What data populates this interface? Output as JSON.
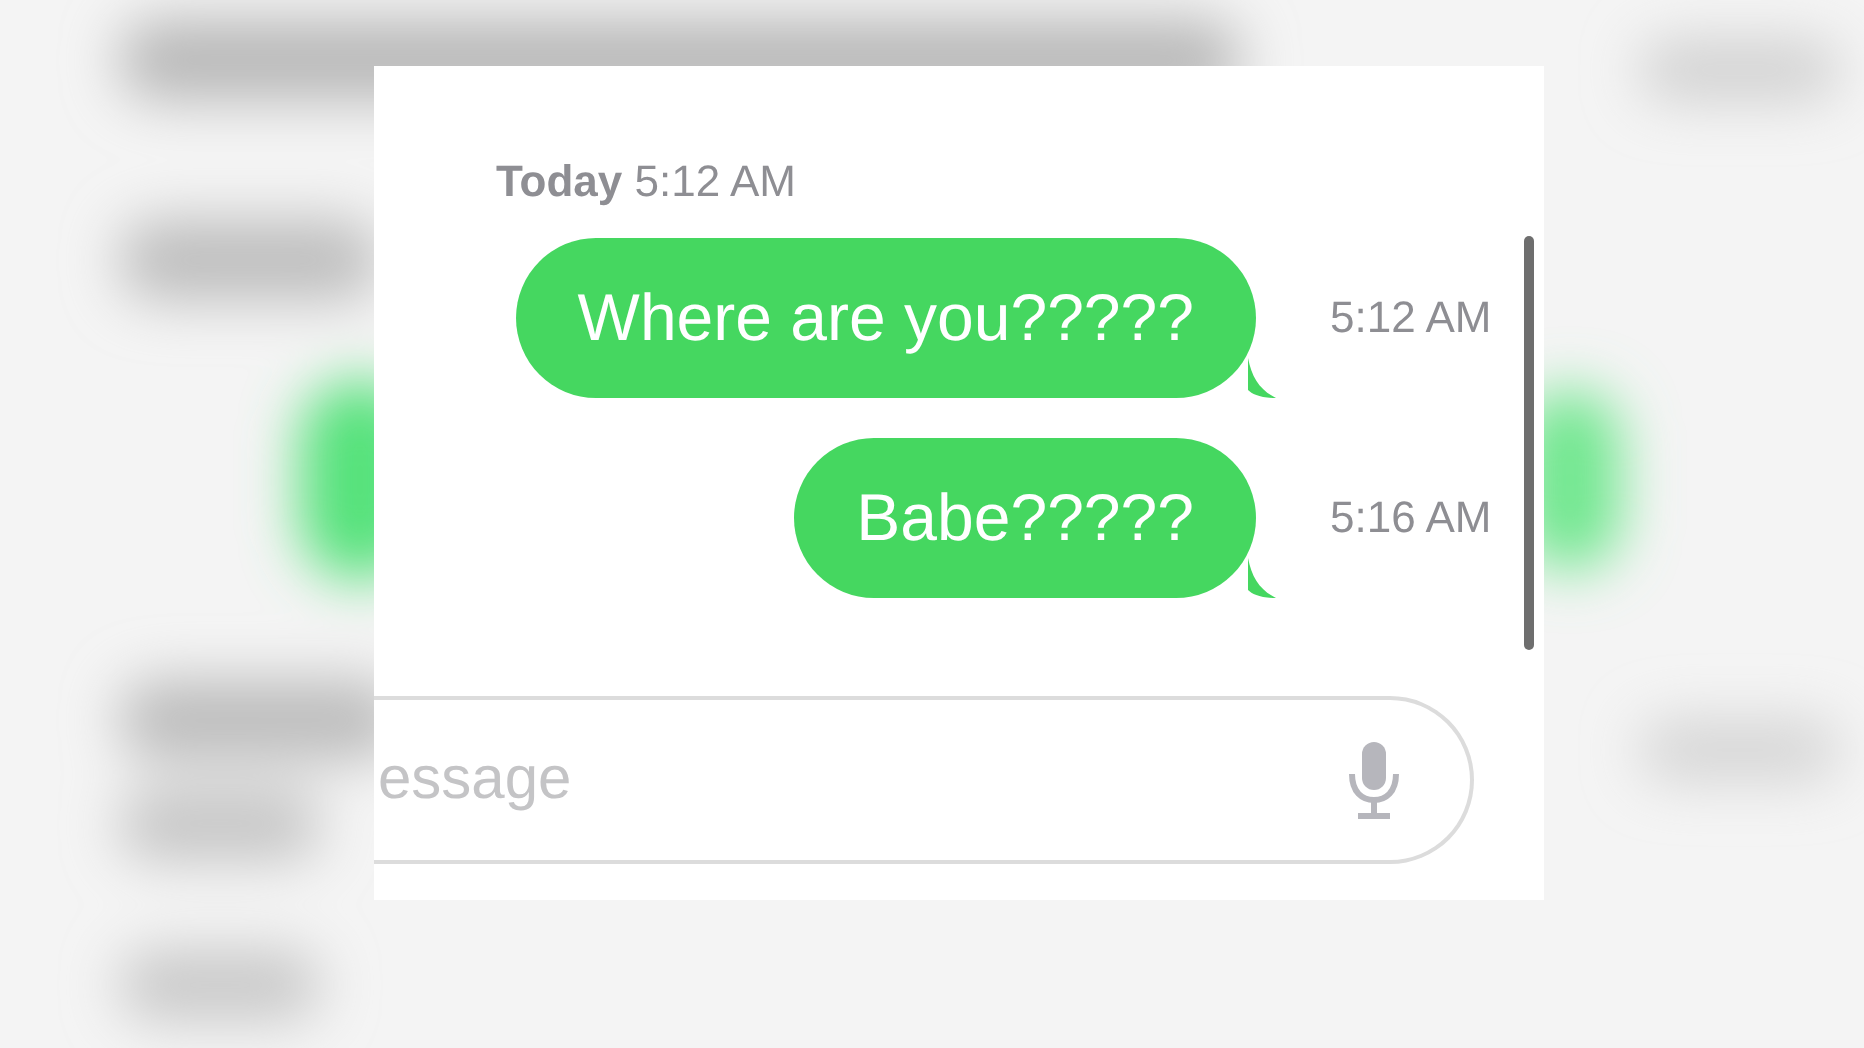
{
  "conversation": {
    "timestamp": "**Today** 5:12 AM",
    "messages": [
      {
        "kind": "sent",
        "text": "Where are you?????",
        "time": "5:12 AM"
      },
      {
        "kind": "sent",
        "text": "Babe?????",
        "time": "5:16 AM"
      }
    ]
  },
  "compose": {
    "placeholder": "essage"
  }
}
